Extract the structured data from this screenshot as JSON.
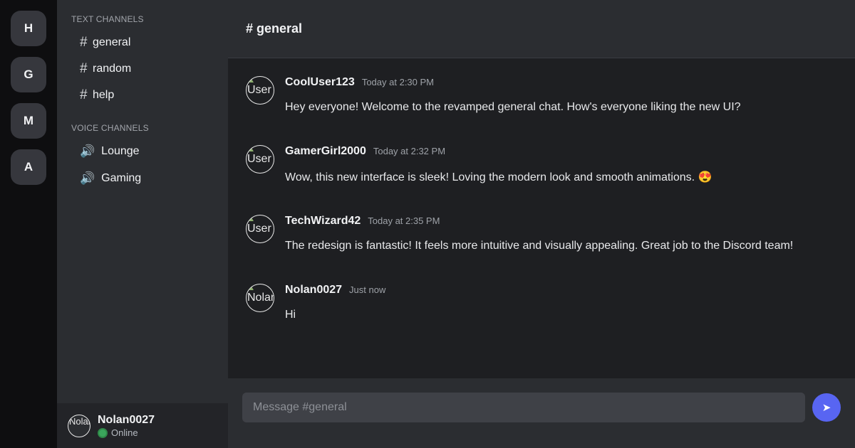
{
  "servers": [
    "H",
    "G",
    "M",
    "A"
  ],
  "sidebar": {
    "text_category": "TEXT CHANNELS",
    "text_channels": [
      "general",
      "random",
      "help"
    ],
    "voice_category": "VOICE CHANNELS",
    "voice_channels": [
      "Lounge",
      "Gaming"
    ],
    "hash_symbol": "#",
    "speaker_symbol": "🔊"
  },
  "user_panel": {
    "avatar_alt": "Nolan",
    "username": "Nolan0027",
    "status": "Online"
  },
  "header": {
    "title": "# general"
  },
  "messages": [
    {
      "avatar_alt": "User",
      "author": "CoolUser123",
      "time": "Today at 2:30 PM",
      "text": "Hey everyone! Welcome to the revamped general chat. How's everyone liking the new UI?"
    },
    {
      "avatar_alt": "User",
      "author": "GamerGirl2000",
      "time": "Today at 2:32 PM",
      "text": "Wow, this new interface is sleek! Loving the modern look and smooth animations. 😍"
    },
    {
      "avatar_alt": "User",
      "author": "TechWizard42",
      "time": "Today at 2:35 PM",
      "text": "The redesign is fantastic! It feels more intuitive and visually appealing. Great job to the Discord team!"
    },
    {
      "avatar_alt": "Nolan",
      "author": "Nolan0027",
      "time": "Just now",
      "text": "Hi"
    }
  ],
  "composer": {
    "placeholder": "Message #general",
    "send_icon": "➤"
  },
  "colors": {
    "accent": "#5865f2",
    "online": "#3ba55c"
  }
}
